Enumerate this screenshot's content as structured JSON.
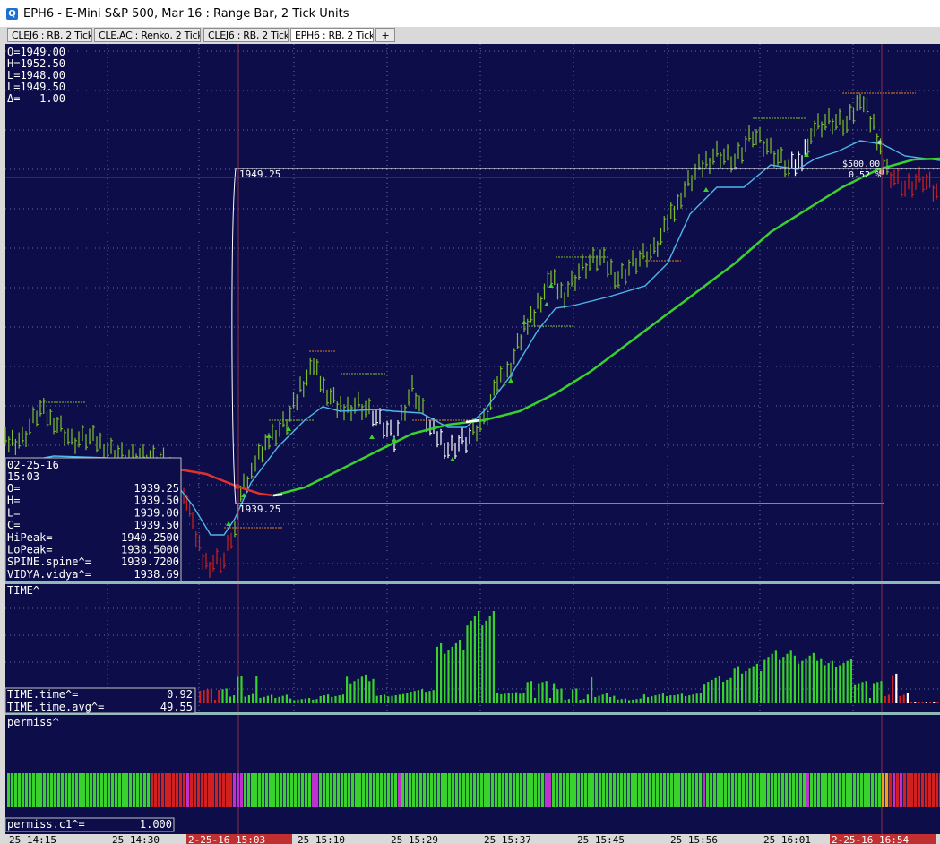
{
  "window": {
    "title": "EPH6 - E-Mini S&P 500, Mar 16 : Range Bar, 2 Tick Units",
    "icon": "chart-app-icon"
  },
  "tabs": [
    {
      "label": "CLEJ6 : RB, 2 Tick",
      "active": false
    },
    {
      "label": "CLE,AC : Renko, 2 Tick",
      "active": false
    },
    {
      "label": "CLEJ6 : RB, 2 Tick",
      "active": false
    },
    {
      "label": "EPH6 : RB, 2 Tick",
      "active": true
    },
    {
      "label": "+",
      "active": false
    }
  ],
  "ohlc_top": [
    "O=1949.00",
    "H=1952.50",
    "L=1948.00",
    "L=1949.50",
    "Δ=  -1.00"
  ],
  "price_labels": {
    "upper": "1949.25",
    "lower": "1939.25",
    "pnl": "$500.00",
    "pct": "0.52 %"
  },
  "data_window": {
    "date": "02-25-16",
    "time": "15:03",
    "rows": [
      {
        "label": "O=",
        "value": "1939.25"
      },
      {
        "label": "H=",
        "value": "1939.50"
      },
      {
        "label": "L=",
        "value": "1939.00"
      },
      {
        "label": "C=",
        "value": "1939.50"
      },
      {
        "label": "HiPeak=",
        "value": "1940.2500"
      },
      {
        "label": "LoPeak=",
        "value": "1938.5000"
      },
      {
        "label": "SPINE.spine^=",
        "value": "1939.7200"
      },
      {
        "label": "VIDYA.vidya^=",
        "value": "1938.69"
      }
    ]
  },
  "time_panel": {
    "title": "TIME^",
    "rows": [
      {
        "label": "TIME.time^=",
        "value": "0.92"
      },
      {
        "label": "TIME.time.avg^=",
        "value": "49.55"
      }
    ]
  },
  "permiss_panel": {
    "title": "permiss^",
    "rows": [
      {
        "label": "permiss.c1^=",
        "value": "1.000"
      }
    ]
  },
  "time_axis": [
    "25 14:15",
    "25 14:30",
    "2-25-16 15:03",
    "25 15:10",
    "25 15:29",
    "25 15:37",
    "25 15:45",
    "25 15:56",
    "25 16:01",
    "2-25-16 16:54"
  ],
  "colors": {
    "background": "#0d0d4a",
    "up_bar": "#7fbf2a",
    "down_bar": "#d02020",
    "neutral_bar": "#ffffff",
    "spine": "#4fb8e8",
    "vidya_up": "#39d12c",
    "vidya_down": "#e03030",
    "crosshair": "#8a2f4a"
  },
  "chart_data": [
    {
      "type": "line",
      "title": "",
      "note": "price range bars with SPINE (light blue) and VIDYA (green/red) overlays",
      "x": [
        "25 14:15",
        "25 14:30",
        "2-25-16 15:03",
        "25 15:10",
        "25 15:29",
        "25 15:37",
        "25 15:45",
        "25 15:56",
        "25 16:01",
        "2-25-16 16:54"
      ],
      "series": [
        {
          "values": [
            1941.5,
            1940.0,
            1939.5,
            1943.5,
            1942.0,
            1944.5,
            1947.5,
            1949.5,
            1950.5,
            1949.0
          ]
        },
        {
          "values": [
            1941.3,
            1940.2,
            1939.7,
            1942.5,
            1942.0,
            1943.5,
            1947.0,
            1948.7,
            1950.2,
            1949.5
          ]
        },
        {
          "values": [
            1941.0,
            1940.8,
            1938.69,
            1939.5,
            1941.5,
            1942.0,
            1944.0,
            1946.5,
            1948.5,
            1949.2
          ]
        }
      ],
      "y_reference_lines": [
        1949.25,
        1939.25
      ]
    },
    {
      "type": "bar",
      "title": "TIME^",
      "values": [
        8,
        15,
        12,
        6,
        9,
        25,
        7,
        10,
        40,
        55,
        6,
        12,
        8,
        14,
        6,
        10,
        9,
        22,
        28,
        35,
        30,
        24,
        12,
        16,
        0.92
      ],
      "avg": 49.55
    },
    {
      "type": "bar",
      "title": "permiss^",
      "values": [
        1.0,
        1.0,
        0.0,
        1.0,
        1.0,
        1.0,
        1.0,
        1.0,
        1.0,
        0.0
      ],
      "last": 1.0
    }
  ]
}
